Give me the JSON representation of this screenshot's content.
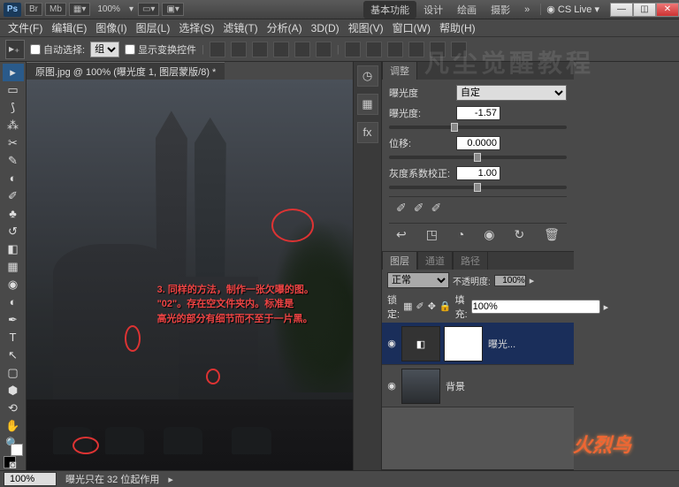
{
  "titlebar": {
    "ps": "Ps",
    "br": "Br",
    "mb": "Mb",
    "zoom": "100%",
    "workspaces": [
      "基本功能",
      "设计",
      "绘画",
      "摄影"
    ],
    "active_ws": 0,
    "cslive": "CS Live"
  },
  "menu": [
    "文件(F)",
    "编辑(E)",
    "图像(I)",
    "图层(L)",
    "选择(S)",
    "滤镜(T)",
    "分析(A)",
    "3D(D)",
    "视图(V)",
    "窗口(W)",
    "帮助(H)"
  ],
  "optbar": {
    "autoselect": "自动选择:",
    "group": "组",
    "showcontrols": "显示变换控件"
  },
  "doc_tab": "原图.jpg @ 100% (曝光度 1, 图层蒙版/8) *",
  "annotation": "3. 同样的方法，制作一张欠曝的图。\n\"02\"。存在空文件夹内。标准是\n高光的部分有细节而不至于一片黑。",
  "watermark_main": "凡尘觉醒教程",
  "adjust": {
    "tab": "调整",
    "title": "曝光度",
    "preset": "自定",
    "exposure_label": "曝光度:",
    "exposure_val": "-1.57",
    "offset_label": "位移:",
    "offset_val": "0.0000",
    "gamma_label": "灰度系数校正:",
    "gamma_val": "1.00"
  },
  "layers": {
    "tabs": [
      "图层",
      "通道",
      "路径"
    ],
    "blend": "正常",
    "opacity_label": "不透明度:",
    "opacity_val": "100%",
    "lock_label": "锁定:",
    "fill_label": "填充:",
    "fill_val": "100%",
    "items": [
      {
        "name": "曝光..."
      },
      {
        "name": "背景"
      }
    ]
  },
  "status": {
    "zoom": "100%",
    "info": "曝光只在 32 位起作用"
  }
}
